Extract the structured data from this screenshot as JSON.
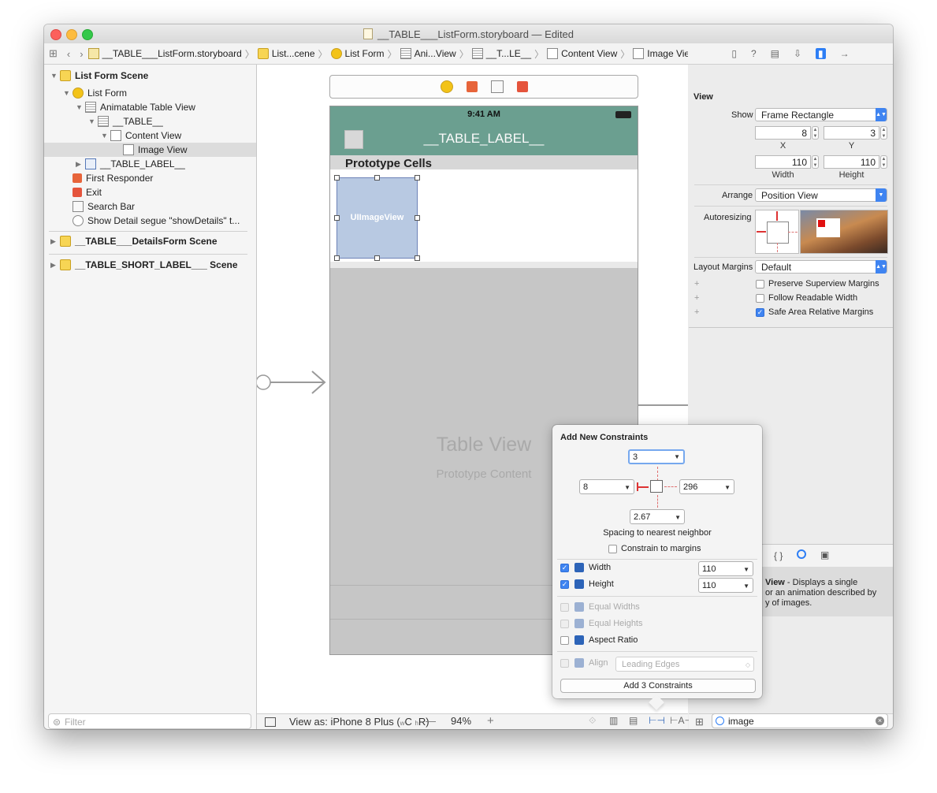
{
  "window": {
    "title": "__TABLE___ListForm.storyboard — Edited"
  },
  "jumpbar": {
    "crumbs": [
      "__TABLE___ListForm.storyboard",
      "List...cene",
      "List Form",
      "Ani...View",
      "__T...LE__",
      "Content View",
      "Image View"
    ]
  },
  "navigator": {
    "items": [
      "List Form Scene",
      "List Form",
      "Animatable Table View",
      "__TABLE__",
      "Content View",
      "Image View",
      "__TABLE_LABEL__",
      "First Responder",
      "Exit",
      "Search Bar",
      "Show Detail segue \"showDetails\" t...",
      "__TABLE___DetailsForm Scene",
      "__TABLE_SHORT_LABEL___ Scene"
    ],
    "filter_placeholder": "Filter"
  },
  "canvas": {
    "status_time": "9:41 AM",
    "nav_title": "__TABLE_LABEL__",
    "section_header": "Prototype Cells",
    "image_view_label": "UIImageView",
    "table_view_label": "Table View",
    "table_view_sub": "Prototype Content"
  },
  "canvas_bottom": {
    "view_as": "View as: iPhone 8 Plus (",
    "w": "w",
    "c": "C",
    "h": "h",
    "r": "R)",
    "zoom": "94%",
    "minus": "—",
    "plus": "+"
  },
  "inspector": {
    "section": "View",
    "show_label": "Show",
    "show_value": "Frame Rectangle",
    "x_value": "8",
    "y_value": "3",
    "x_caption": "X",
    "y_caption": "Y",
    "width_value": "110",
    "height_value": "110",
    "width_caption": "Width",
    "height_caption": "Height",
    "arrange_label": "Arrange",
    "arrange_value": "Position View",
    "autoresizing_label": "Autoresizing",
    "layout_margins_label": "Layout Margins",
    "layout_margins_value": "Default",
    "preserve": "Preserve Superview Margins",
    "follow": "Follow Readable Width",
    "safe": "Safe Area Relative Margins",
    "plus": "+"
  },
  "library": {
    "desc_bold": "View",
    "desc_line1": " - Displays a single",
    "desc_line2": "or an animation described by",
    "desc_line3": "y of images.",
    "search_value": "image"
  },
  "constraints_popup": {
    "title": "Add New Constraints",
    "top": "3",
    "left": "8",
    "right": "296",
    "bottom": "2.67",
    "spacing_label": "Spacing to nearest neighbor",
    "constrain_margins": "Constrain to margins",
    "width_label": "Width",
    "width_value": "110",
    "height_label": "Height",
    "height_value": "110",
    "equal_widths": "Equal Widths",
    "equal_heights": "Equal Heights",
    "aspect_ratio": "Aspect Ratio",
    "align_label": "Align",
    "align_value": "Leading Edges",
    "add_button": "Add 3 Constraints"
  }
}
